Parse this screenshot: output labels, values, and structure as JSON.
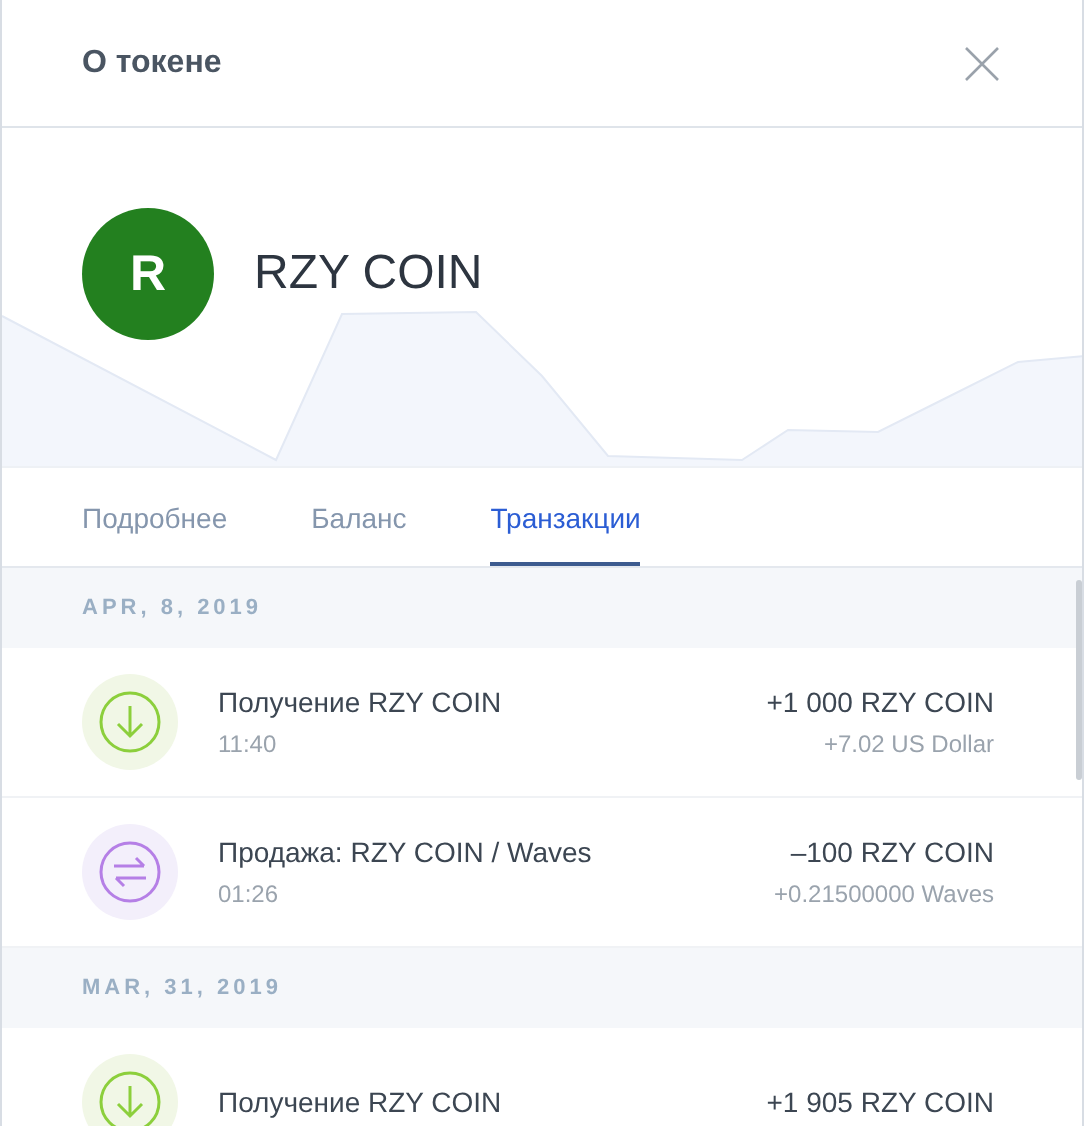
{
  "window": {
    "title": "О токене"
  },
  "token": {
    "letter": "R",
    "name": "RZY COIN",
    "color": "#23801f"
  },
  "tabs": [
    {
      "label": "Подробнее",
      "selected": false
    },
    {
      "label": "Баланс",
      "selected": false
    },
    {
      "label": "Транзакции",
      "selected": true
    }
  ],
  "groups": [
    {
      "date": "APR, 8, 2019",
      "transactions": [
        {
          "kind": "receive",
          "title": "Получение RZY COIN",
          "time": "11:40",
          "amount": "+1 000 RZY COIN",
          "secondary": "+7.02 US Dollar"
        },
        {
          "kind": "exchange",
          "title": "Продажа: RZY COIN / Waves",
          "time": "01:26",
          "amount": "–100 RZY COIN",
          "secondary": "+0.21500000 Waves"
        }
      ]
    },
    {
      "date": "MAR, 31, 2019",
      "transactions": [
        {
          "kind": "receive",
          "title": "Получение RZY COIN",
          "amount": "+1 905 RZY COIN"
        }
      ]
    }
  ]
}
